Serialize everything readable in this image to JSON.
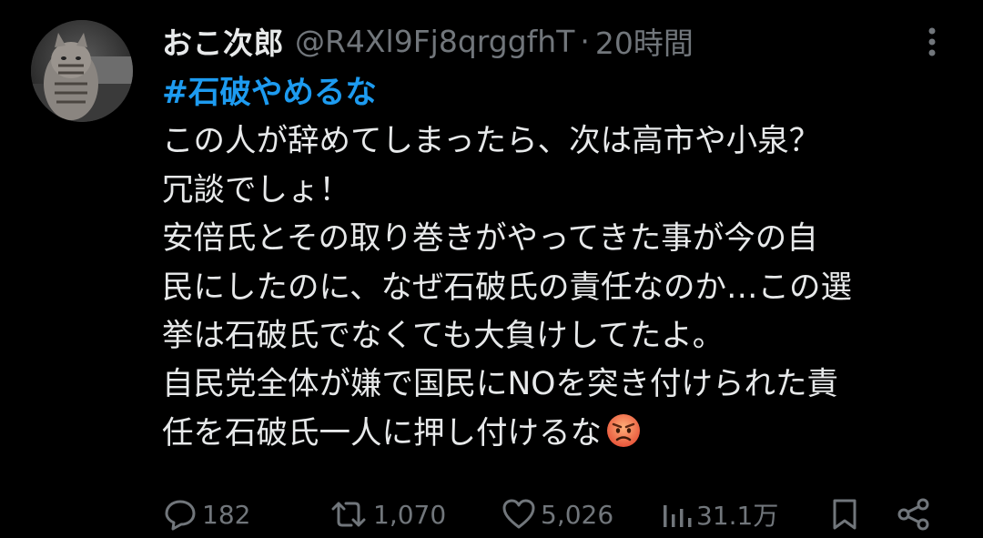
{
  "tweet": {
    "display_name": "おこ次郎",
    "handle": "@R4Xl9Fj8qrggfhT",
    "separator": "·",
    "time": "20時間",
    "hashtag": "#石破やめるな",
    "lines": [
      "この人が辞めてしまったら、次は高市や小泉？",
      "冗談でしょ！",
      "安倍氏とその取り巻きがやってきた事が今の自",
      "民にしたのに、なぜ石破氏の責任なのか…この選",
      "挙は石破氏でなくても大負けしてたよ。",
      "自民党全体が嫌で国民にNOを突き付けられた責",
      "任を石破氏一人に押し付けるな"
    ],
    "emoji_icon": "angry-face-icon"
  },
  "actions": {
    "reply": {
      "icon": "reply-icon",
      "count": "182"
    },
    "retweet": {
      "icon": "retweet-icon",
      "count": "1,070"
    },
    "like": {
      "icon": "heart-icon",
      "count": "5,026"
    },
    "views": {
      "icon": "views-chart-icon",
      "count": "31.1万"
    },
    "bookmark": {
      "icon": "bookmark-icon"
    },
    "share": {
      "icon": "share-icon"
    }
  },
  "colors": {
    "background": "#000000",
    "text_primary": "#e7e9ea",
    "text_secondary": "#71767b",
    "link": "#1d9bf0"
  }
}
